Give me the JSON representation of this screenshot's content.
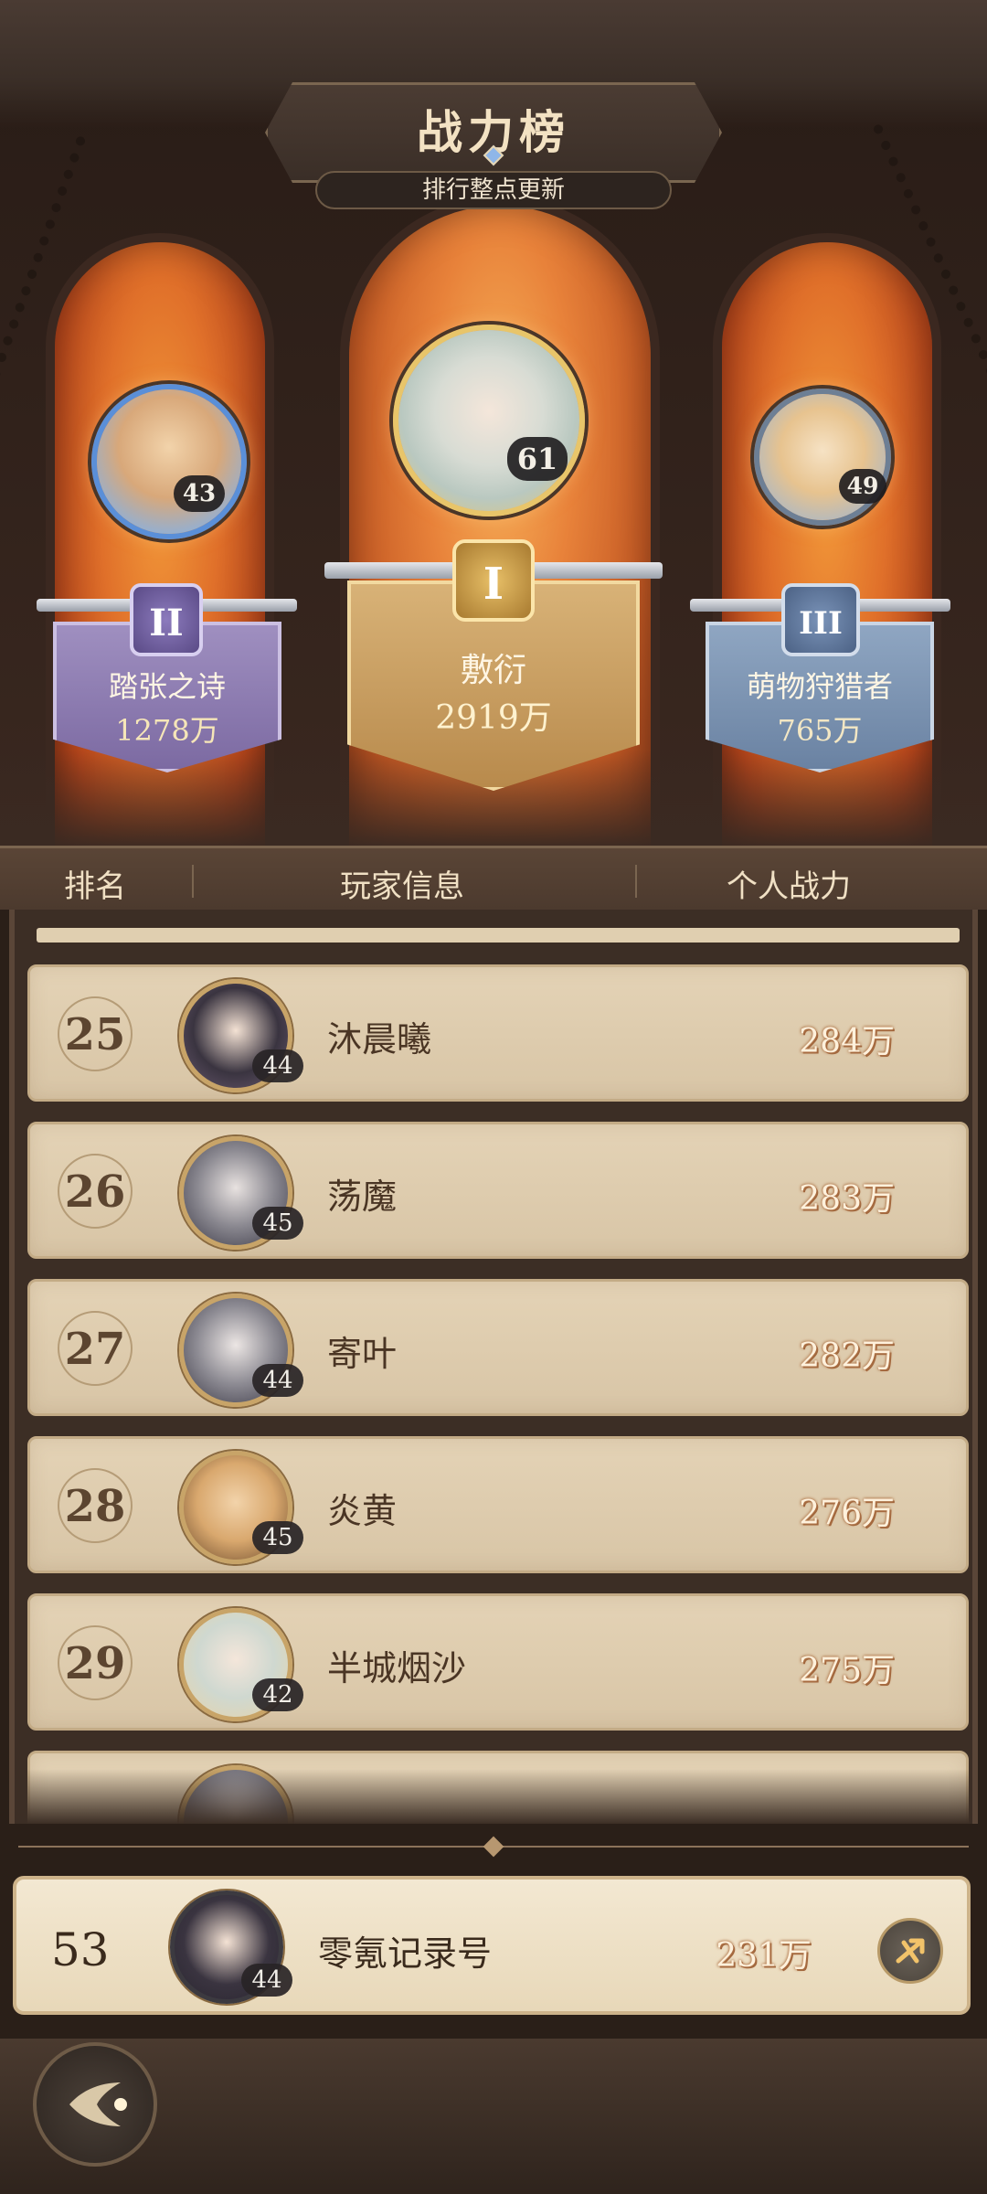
{
  "header": {
    "title": "战力榜",
    "subtitle": "排行整点更新"
  },
  "podium": {
    "first": {
      "name": "敷衍",
      "score": "2919万",
      "level": "61",
      "rank": "I"
    },
    "second": {
      "name": "踏张之诗",
      "score": "1278万",
      "level": "43",
      "rank": "II"
    },
    "third": {
      "name": "萌物狩猎者",
      "score": "765万",
      "level": "49",
      "rank": "III"
    }
  },
  "list_header": {
    "rank": "排名",
    "player": "玩家信息",
    "power": "个人战力"
  },
  "rows": [
    {
      "rank": "25",
      "name": "沐晨曦",
      "level": "44",
      "score": "284万"
    },
    {
      "rank": "26",
      "name": "荡魔",
      "level": "45",
      "score": "283万"
    },
    {
      "rank": "27",
      "name": "寄叶",
      "level": "44",
      "score": "282万"
    },
    {
      "rank": "28",
      "name": "炎黄",
      "level": "45",
      "score": "276万"
    },
    {
      "rank": "29",
      "name": "半城烟沙",
      "level": "42",
      "score": "275万"
    }
  ],
  "my_entry": {
    "rank": "53",
    "name": "零氪记录号",
    "level": "44",
    "score": "231万"
  },
  "colors": {
    "accent_gold": "#c9a96a",
    "score_text": "#fff1dc",
    "arch_orange": "#e0702a"
  },
  "icons": {
    "back": "back-arrow-icon",
    "share": "share-icon"
  }
}
